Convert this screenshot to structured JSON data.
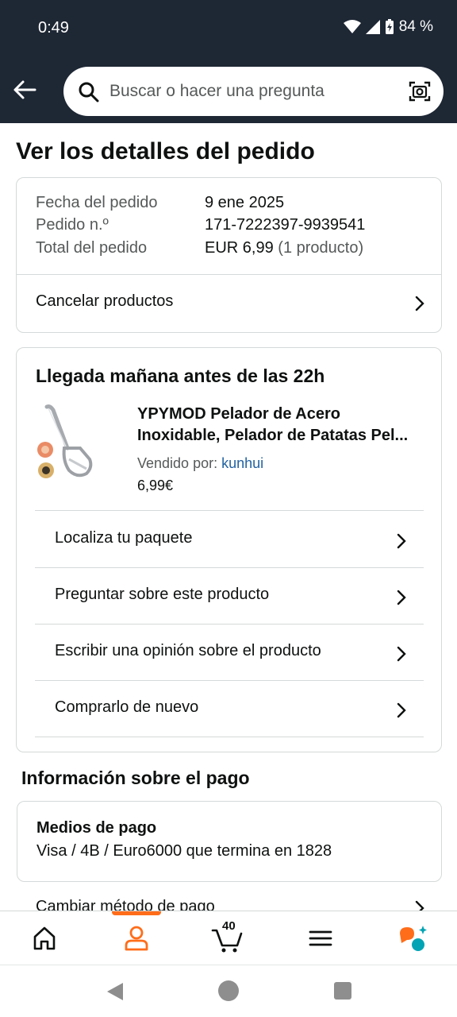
{
  "status_bar": {
    "time": "0:49",
    "battery": "84 %"
  },
  "search": {
    "placeholder": "Buscar o hacer una pregunta"
  },
  "page": {
    "title": "Ver los detalles del pedido"
  },
  "order_summary": {
    "date_label": "Fecha del pedido",
    "date_value": "9 ene 2025",
    "number_label": "Pedido n.º",
    "number_value": "171-7222397-9939541",
    "total_label": "Total del pedido",
    "total_value": "EUR 6,99",
    "total_items": "(1 producto)",
    "cancel_label": "Cancelar productos"
  },
  "shipment": {
    "heading": "Llegada mañana antes de las 22h",
    "product_title_line1": "YPYMOD Pelador de Acero",
    "product_title_line2": "Inoxidable, Pelador de Patatas Pel...",
    "sold_by_label": "Vendido por:",
    "seller": "kunhui",
    "price": "6,99€",
    "actions": [
      {
        "label": "Localiza tu paquete"
      },
      {
        "label": "Preguntar sobre este producto"
      },
      {
        "label": "Escribir una opinión sobre el producto"
      },
      {
        "label": "Comprarlo de nuevo"
      }
    ]
  },
  "payment": {
    "section_title": "Información sobre el pago",
    "method_title": "Medios de pago",
    "method_value": "Visa / 4B / Euro6000  que termina en 1828",
    "change_label": "Cambiar método de pago"
  },
  "bottom_nav": {
    "cart_count": "40",
    "active": "account"
  },
  "colors": {
    "header_bg": "#1e2734",
    "accent": "#ff6d1a",
    "link": "#2162a1",
    "border": "#d5d9d9"
  }
}
